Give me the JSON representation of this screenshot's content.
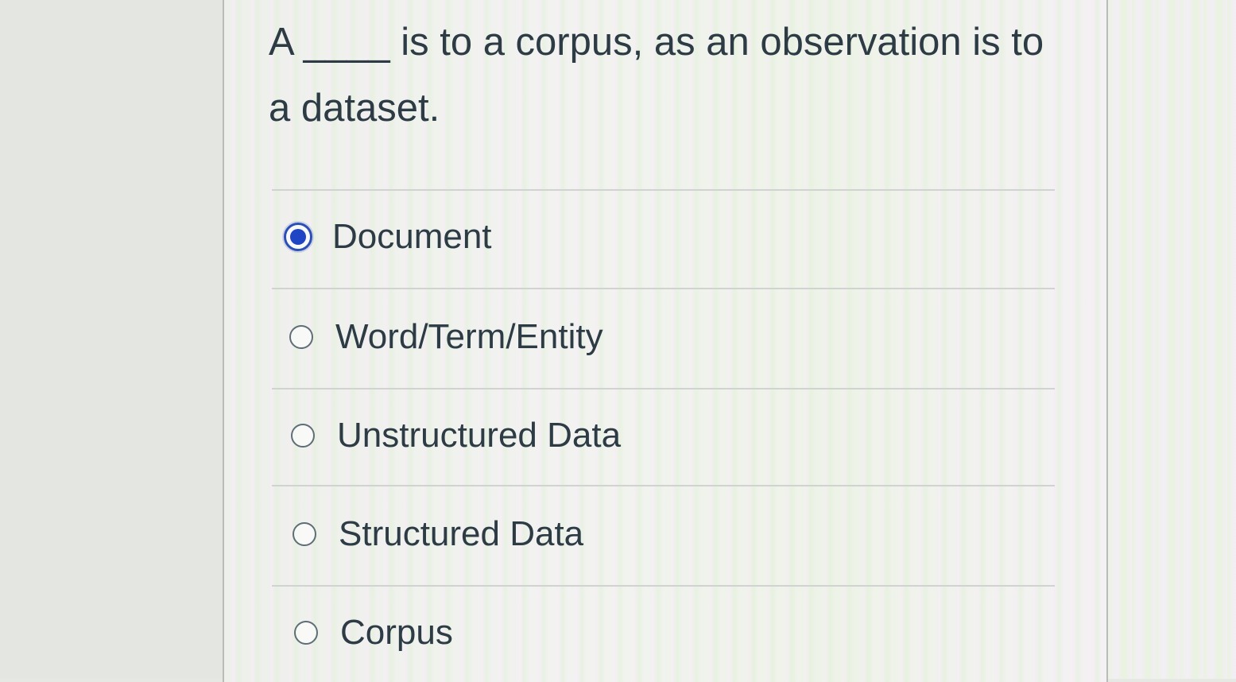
{
  "question": {
    "text": "A ____ is to a corpus, as an observation is to a dataset."
  },
  "options": [
    {
      "label": "Document",
      "selected": true
    },
    {
      "label": "Word/Term/Entity",
      "selected": false
    },
    {
      "label": "Unstructured Data",
      "selected": false
    },
    {
      "label": "Structured Data",
      "selected": false
    },
    {
      "label": "Corpus",
      "selected": false
    }
  ],
  "colors": {
    "radio_selected": "#1f44c4",
    "text": "#2d3b45"
  }
}
